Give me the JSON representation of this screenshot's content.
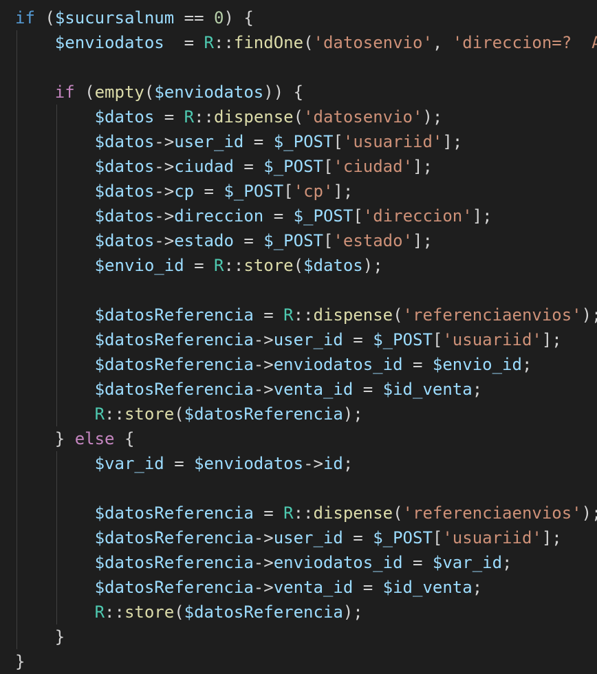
{
  "editor": {
    "language": "php",
    "theme": {
      "background": "#1e1e1e",
      "indent_guide": "#404040",
      "token_colors": {
        "kw": "#569cd6",
        "ctrl": "#c586c0",
        "var": "#9cdcfe",
        "fn": "#dcdcaa",
        "cls": "#4ec9b0",
        "str": "#ce9178",
        "num": "#b5cea8",
        "op": "#d4d4d4",
        "punc": "#d4d4d4",
        "const": "#9cdcfe"
      }
    },
    "lines": [
      {
        "indent": 0,
        "tokens": [
          {
            "t": "if",
            "c": "kw"
          },
          {
            "t": " (",
            "c": "punc"
          },
          {
            "t": "$sucursalnum",
            "c": "var"
          },
          {
            "t": " == ",
            "c": "op"
          },
          {
            "t": "0",
            "c": "num"
          },
          {
            "t": ") {",
            "c": "punc"
          }
        ]
      },
      {
        "indent": 1,
        "tokens": [
          {
            "t": "$enviodatos",
            "c": "var"
          },
          {
            "t": "  = ",
            "c": "op"
          },
          {
            "t": "R",
            "c": "cls"
          },
          {
            "t": "::",
            "c": "op"
          },
          {
            "t": "findOne",
            "c": "fn"
          },
          {
            "t": "(",
            "c": "punc"
          },
          {
            "t": "'datosenvio'",
            "c": "str"
          },
          {
            "t": ", ",
            "c": "punc"
          },
          {
            "t": "'direccion=?  A",
            "c": "str"
          }
        ]
      },
      {
        "indent": 1,
        "tokens": []
      },
      {
        "indent": 1,
        "tokens": [
          {
            "t": "if",
            "c": "ctrl"
          },
          {
            "t": " (",
            "c": "punc"
          },
          {
            "t": "empty",
            "c": "fn"
          },
          {
            "t": "(",
            "c": "punc"
          },
          {
            "t": "$enviodatos",
            "c": "var"
          },
          {
            "t": ")) {",
            "c": "punc"
          }
        ]
      },
      {
        "indent": 2,
        "tokens": [
          {
            "t": "$datos",
            "c": "var"
          },
          {
            "t": " = ",
            "c": "op"
          },
          {
            "t": "R",
            "c": "cls"
          },
          {
            "t": "::",
            "c": "op"
          },
          {
            "t": "dispense",
            "c": "fn"
          },
          {
            "t": "(",
            "c": "punc"
          },
          {
            "t": "'datosenvio'",
            "c": "str"
          },
          {
            "t": ");",
            "c": "punc"
          }
        ]
      },
      {
        "indent": 2,
        "tokens": [
          {
            "t": "$datos",
            "c": "var"
          },
          {
            "t": "->",
            "c": "op"
          },
          {
            "t": "user_id",
            "c": "var"
          },
          {
            "t": " = ",
            "c": "op"
          },
          {
            "t": "$_POST",
            "c": "var"
          },
          {
            "t": "[",
            "c": "punc"
          },
          {
            "t": "'usuariid'",
            "c": "str"
          },
          {
            "t": "];",
            "c": "punc"
          }
        ]
      },
      {
        "indent": 2,
        "tokens": [
          {
            "t": "$datos",
            "c": "var"
          },
          {
            "t": "->",
            "c": "op"
          },
          {
            "t": "ciudad",
            "c": "var"
          },
          {
            "t": " = ",
            "c": "op"
          },
          {
            "t": "$_POST",
            "c": "var"
          },
          {
            "t": "[",
            "c": "punc"
          },
          {
            "t": "'ciudad'",
            "c": "str"
          },
          {
            "t": "];",
            "c": "punc"
          }
        ]
      },
      {
        "indent": 2,
        "tokens": [
          {
            "t": "$datos",
            "c": "var"
          },
          {
            "t": "->",
            "c": "op"
          },
          {
            "t": "cp",
            "c": "var"
          },
          {
            "t": " = ",
            "c": "op"
          },
          {
            "t": "$_POST",
            "c": "var"
          },
          {
            "t": "[",
            "c": "punc"
          },
          {
            "t": "'cp'",
            "c": "str"
          },
          {
            "t": "];",
            "c": "punc"
          }
        ]
      },
      {
        "indent": 2,
        "tokens": [
          {
            "t": "$datos",
            "c": "var"
          },
          {
            "t": "->",
            "c": "op"
          },
          {
            "t": "direccion",
            "c": "var"
          },
          {
            "t": " = ",
            "c": "op"
          },
          {
            "t": "$_POST",
            "c": "var"
          },
          {
            "t": "[",
            "c": "punc"
          },
          {
            "t": "'direccion'",
            "c": "str"
          },
          {
            "t": "];",
            "c": "punc"
          }
        ]
      },
      {
        "indent": 2,
        "tokens": [
          {
            "t": "$datos",
            "c": "var"
          },
          {
            "t": "->",
            "c": "op"
          },
          {
            "t": "estado",
            "c": "var"
          },
          {
            "t": " = ",
            "c": "op"
          },
          {
            "t": "$_POST",
            "c": "var"
          },
          {
            "t": "[",
            "c": "punc"
          },
          {
            "t": "'estado'",
            "c": "str"
          },
          {
            "t": "];",
            "c": "punc"
          }
        ]
      },
      {
        "indent": 2,
        "tokens": [
          {
            "t": "$envio_id",
            "c": "var"
          },
          {
            "t": " = ",
            "c": "op"
          },
          {
            "t": "R",
            "c": "cls"
          },
          {
            "t": "::",
            "c": "op"
          },
          {
            "t": "store",
            "c": "fn"
          },
          {
            "t": "(",
            "c": "punc"
          },
          {
            "t": "$datos",
            "c": "var"
          },
          {
            "t": ");",
            "c": "punc"
          }
        ]
      },
      {
        "indent": 2,
        "tokens": []
      },
      {
        "indent": 2,
        "tokens": [
          {
            "t": "$datosReferencia",
            "c": "var"
          },
          {
            "t": " = ",
            "c": "op"
          },
          {
            "t": "R",
            "c": "cls"
          },
          {
            "t": "::",
            "c": "op"
          },
          {
            "t": "dispense",
            "c": "fn"
          },
          {
            "t": "(",
            "c": "punc"
          },
          {
            "t": "'referenciaenvios'",
            "c": "str"
          },
          {
            "t": ");",
            "c": "punc"
          }
        ]
      },
      {
        "indent": 2,
        "tokens": [
          {
            "t": "$datosReferencia",
            "c": "var"
          },
          {
            "t": "->",
            "c": "op"
          },
          {
            "t": "user_id",
            "c": "var"
          },
          {
            "t": " = ",
            "c": "op"
          },
          {
            "t": "$_POST",
            "c": "var"
          },
          {
            "t": "[",
            "c": "punc"
          },
          {
            "t": "'usuariid'",
            "c": "str"
          },
          {
            "t": "];",
            "c": "punc"
          }
        ]
      },
      {
        "indent": 2,
        "tokens": [
          {
            "t": "$datosReferencia",
            "c": "var"
          },
          {
            "t": "->",
            "c": "op"
          },
          {
            "t": "enviodatos_id",
            "c": "var"
          },
          {
            "t": " = ",
            "c": "op"
          },
          {
            "t": "$envio_id",
            "c": "var"
          },
          {
            "t": ";",
            "c": "punc"
          }
        ]
      },
      {
        "indent": 2,
        "tokens": [
          {
            "t": "$datosReferencia",
            "c": "var"
          },
          {
            "t": "->",
            "c": "op"
          },
          {
            "t": "venta_id",
            "c": "var"
          },
          {
            "t": " = ",
            "c": "op"
          },
          {
            "t": "$id_venta",
            "c": "var"
          },
          {
            "t": ";",
            "c": "punc"
          }
        ]
      },
      {
        "indent": 2,
        "tokens": [
          {
            "t": "R",
            "c": "cls"
          },
          {
            "t": "::",
            "c": "op"
          },
          {
            "t": "store",
            "c": "fn"
          },
          {
            "t": "(",
            "c": "punc"
          },
          {
            "t": "$datosReferencia",
            "c": "var"
          },
          {
            "t": ");",
            "c": "punc"
          }
        ]
      },
      {
        "indent": 1,
        "tokens": [
          {
            "t": "} ",
            "c": "punc"
          },
          {
            "t": "else",
            "c": "ctrl"
          },
          {
            "t": " {",
            "c": "punc"
          }
        ]
      },
      {
        "indent": 2,
        "tokens": [
          {
            "t": "$var_id",
            "c": "var"
          },
          {
            "t": " = ",
            "c": "op"
          },
          {
            "t": "$enviodatos",
            "c": "var"
          },
          {
            "t": "->",
            "c": "op"
          },
          {
            "t": "id",
            "c": "var"
          },
          {
            "t": ";",
            "c": "punc"
          }
        ]
      },
      {
        "indent": 2,
        "tokens": []
      },
      {
        "indent": 2,
        "tokens": [
          {
            "t": "$datosReferencia",
            "c": "var"
          },
          {
            "t": " = ",
            "c": "op"
          },
          {
            "t": "R",
            "c": "cls"
          },
          {
            "t": "::",
            "c": "op"
          },
          {
            "t": "dispense",
            "c": "fn"
          },
          {
            "t": "(",
            "c": "punc"
          },
          {
            "t": "'referenciaenvios'",
            "c": "str"
          },
          {
            "t": ");",
            "c": "punc"
          }
        ]
      },
      {
        "indent": 2,
        "tokens": [
          {
            "t": "$datosReferencia",
            "c": "var"
          },
          {
            "t": "->",
            "c": "op"
          },
          {
            "t": "user_id",
            "c": "var"
          },
          {
            "t": " = ",
            "c": "op"
          },
          {
            "t": "$_POST",
            "c": "var"
          },
          {
            "t": "[",
            "c": "punc"
          },
          {
            "t": "'usuariid'",
            "c": "str"
          },
          {
            "t": "];",
            "c": "punc"
          }
        ]
      },
      {
        "indent": 2,
        "tokens": [
          {
            "t": "$datosReferencia",
            "c": "var"
          },
          {
            "t": "->",
            "c": "op"
          },
          {
            "t": "enviodatos_id",
            "c": "var"
          },
          {
            "t": " = ",
            "c": "op"
          },
          {
            "t": "$var_id",
            "c": "var"
          },
          {
            "t": ";",
            "c": "punc"
          }
        ]
      },
      {
        "indent": 2,
        "tokens": [
          {
            "t": "$datosReferencia",
            "c": "var"
          },
          {
            "t": "->",
            "c": "op"
          },
          {
            "t": "venta_id",
            "c": "var"
          },
          {
            "t": " = ",
            "c": "op"
          },
          {
            "t": "$id_venta",
            "c": "var"
          },
          {
            "t": ";",
            "c": "punc"
          }
        ]
      },
      {
        "indent": 2,
        "tokens": [
          {
            "t": "R",
            "c": "cls"
          },
          {
            "t": "::",
            "c": "op"
          },
          {
            "t": "store",
            "c": "fn"
          },
          {
            "t": "(",
            "c": "punc"
          },
          {
            "t": "$datosReferencia",
            "c": "var"
          },
          {
            "t": ");",
            "c": "punc"
          }
        ]
      },
      {
        "indent": 1,
        "tokens": [
          {
            "t": "}",
            "c": "punc"
          }
        ]
      },
      {
        "indent": 0,
        "tokens": [
          {
            "t": "}",
            "c": "punc"
          }
        ]
      }
    ]
  }
}
